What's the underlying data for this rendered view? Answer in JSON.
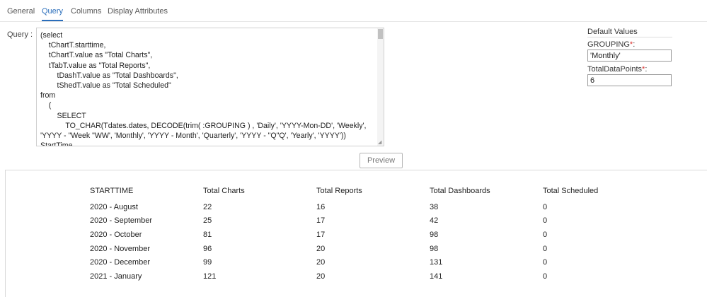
{
  "tabs": [
    {
      "label": "General"
    },
    {
      "label": "Query"
    },
    {
      "label": "Columns"
    },
    {
      "label": "Display Attributes"
    }
  ],
  "active_tab": "Query",
  "query": {
    "label": "Query :",
    "text": "(select\n    tChartT.starttime,\n    tChartT.value as \"Total Charts\",\n    tTabT.value as \"Total Reports\",\n        tDashT.value as \"Total Dashboards\",\n        tShedT.value as \"Total Scheduled\"\nfrom\n    (\n        SELECT\n            TO_CHAR(Tdates.dates, DECODE(trim( :GROUPING ) , 'Daily', 'YYYY-Mon-DD', 'Weekly', 'YYYY - \"Week \"WW', 'Monthly', 'YYYY - Month', 'Quarterly', 'YYYY - \"Q\"Q', 'Yearly', 'YYYY')) StartTime,"
  },
  "defaults": {
    "title": "Default Values",
    "grouping": {
      "label": "GROUPING",
      "required_mark": "*",
      "colon": ":",
      "value": "'Monthly'"
    },
    "total_data_points": {
      "label": "TotalDataPoints",
      "required_mark": "*",
      "colon": ":",
      "value": "6"
    }
  },
  "preview_button": "Preview",
  "results": {
    "columns": [
      "STARTTIME",
      "Total Charts",
      "Total Reports",
      "Total Dashboards",
      "Total Scheduled"
    ],
    "rows": [
      [
        "2020 - August",
        "22",
        "16",
        "38",
        "0"
      ],
      [
        "2020 - September",
        "25",
        "17",
        "42",
        "0"
      ],
      [
        "2020 - October",
        "81",
        "17",
        "98",
        "0"
      ],
      [
        "2020 - November",
        "96",
        "20",
        "98",
        "0"
      ],
      [
        "2020 - December",
        "99",
        "20",
        "131",
        "0"
      ],
      [
        "2021 - January",
        "121",
        "20",
        "141",
        "0"
      ]
    ]
  },
  "colors": {
    "accent": "#2a6ebb",
    "required": "#d9302c"
  }
}
